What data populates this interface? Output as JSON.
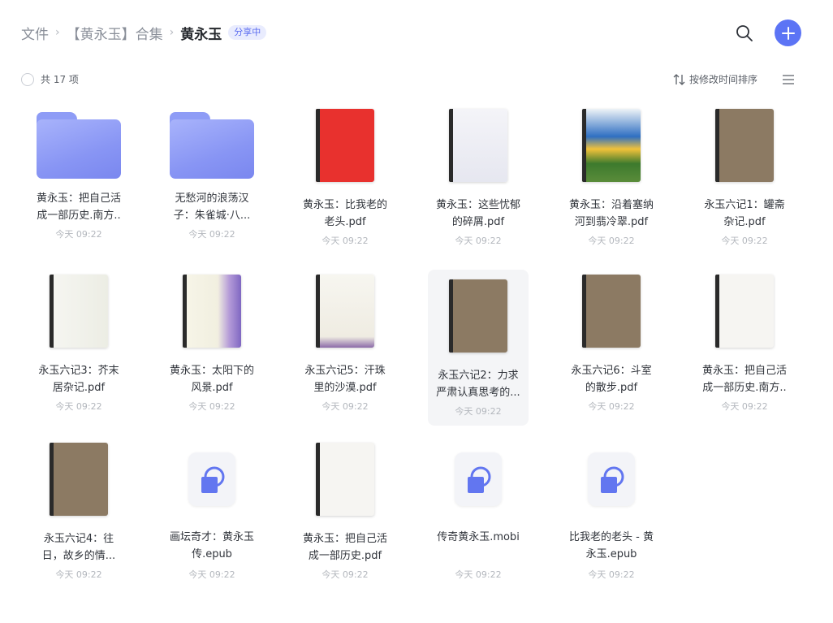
{
  "breadcrumb": {
    "root": "文件",
    "collection": "【黄永玉】合集",
    "current": "黄永玉",
    "badge": "分享中"
  },
  "toolbar": {
    "count": "共 17 项",
    "sort_label": "按修改时间排序"
  },
  "colors": {
    "accent": "#5c74f5",
    "folder": "#8e9cf6"
  },
  "files": [
    {
      "name": "黄永玉：把自己活成一部历史.南方..",
      "time": "今天 09:22",
      "kind": "folder",
      "icon": "folder-icon"
    },
    {
      "name": "无愁河的浪荡汉子：朱雀城·八...",
      "time": "今天 09:22",
      "kind": "folder",
      "icon": "folder-icon"
    },
    {
      "name": "黄永玉：比我老的老头.pdf",
      "time": "今天 09:22",
      "kind": "book",
      "icon": "book-cover-icon"
    },
    {
      "name": "黄永玉：这些忧郁的碎屑.pdf",
      "time": "今天 09:22",
      "kind": "book",
      "icon": "book-cover-icon"
    },
    {
      "name": "黄永玉：沿着塞纳河到翡冷翠.pdf",
      "time": "今天 09:22",
      "kind": "book",
      "icon": "book-cover-icon"
    },
    {
      "name": "永玉六记1：罐斋杂记.pdf",
      "time": "今天 09:22",
      "kind": "book",
      "icon": "book-cover-icon"
    },
    {
      "name": "永玉六记3：芥末居杂记.pdf",
      "time": "今天 09:22",
      "kind": "book",
      "icon": "book-cover-icon"
    },
    {
      "name": "黄永玉：太阳下的风景.pdf",
      "time": "今天 09:22",
      "kind": "book",
      "icon": "book-cover-icon"
    },
    {
      "name": "永玉六记5：汗珠里的沙漠.pdf",
      "time": "今天 09:22",
      "kind": "book",
      "icon": "book-cover-icon"
    },
    {
      "name": "永玉六记2：力求严肃认真思考的...",
      "time": "今天 09:22",
      "kind": "book",
      "icon": "book-cover-icon"
    },
    {
      "name": "永玉六记6：斗室的散步.pdf",
      "time": "今天 09:22",
      "kind": "book",
      "icon": "book-cover-icon"
    },
    {
      "name": "黄永玉：把自己活成一部历史.南方..",
      "time": "今天 09:22",
      "kind": "book",
      "icon": "book-cover-icon"
    },
    {
      "name": "永玉六记4：往日，故乡的情...",
      "time": "今天 09:22",
      "kind": "book",
      "icon": "book-cover-icon"
    },
    {
      "name": "画坛奇才：黄永玉传.epub",
      "time": "今天 09:22",
      "kind": "epub",
      "icon": "epub-file-icon"
    },
    {
      "name": "黄永玉：把自己活成一部历史.pdf",
      "time": "今天 09:22",
      "kind": "book",
      "icon": "book-cover-icon"
    },
    {
      "name": "传奇黄永玉.mobi",
      "time": "今天 09:22",
      "kind": "epub",
      "icon": "mobi-file-icon"
    },
    {
      "name": "比我老的老头 - 黄永玉.epub",
      "time": "今天 09:22",
      "kind": "epub",
      "icon": "epub-file-icon"
    }
  ]
}
